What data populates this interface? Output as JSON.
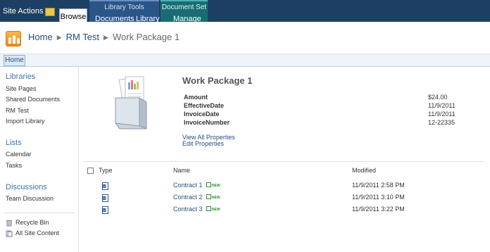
{
  "ribbon": {
    "site_actions": "Site Actions",
    "browse": "Browse",
    "library_tools": {
      "title": "Library Tools",
      "tabs": [
        "Documents",
        "Library"
      ]
    },
    "document_set": {
      "title": "Document Set",
      "tabs": [
        "Manage"
      ]
    }
  },
  "breadcrumb": {
    "items": [
      "Home",
      "RM Test"
    ],
    "current": "Work Package 1"
  },
  "topnav": {
    "home": "Home"
  },
  "quicklaunch": {
    "libraries": {
      "heading": "Libraries",
      "items": [
        "Site Pages",
        "Shared Documents",
        "RM Test",
        "Import Library"
      ]
    },
    "lists": {
      "heading": "Lists",
      "items": [
        "Calendar",
        "Tasks"
      ]
    },
    "discussions": {
      "heading": "Discussions",
      "items": [
        "Team Discussion"
      ]
    },
    "bottom": [
      "Recycle Bin",
      "All Site Content"
    ]
  },
  "docset": {
    "title": "Work Package 1",
    "properties": [
      {
        "label": "Amount",
        "value": "$24.00"
      },
      {
        "label": "EffectiveDate",
        "value": "11/9/2011"
      },
      {
        "label": "InvoiceDate",
        "value": "11/9/2011"
      },
      {
        "label": "InvoiceNumber",
        "value": "12-22335"
      }
    ],
    "links": [
      "View All Properties",
      "Edit Properties"
    ]
  },
  "list": {
    "headers": {
      "type": "Type",
      "name": "Name",
      "modified": "Modified"
    },
    "new_badge": "NEW",
    "rows": [
      {
        "name": "Contract 1",
        "modified": "11/9/2011 2:58 PM"
      },
      {
        "name": "Contract 2",
        "modified": "11/9/2011 3:10 PM"
      },
      {
        "name": "Contract 3",
        "modified": "11/9/2011 3:22 PM"
      }
    ]
  }
}
